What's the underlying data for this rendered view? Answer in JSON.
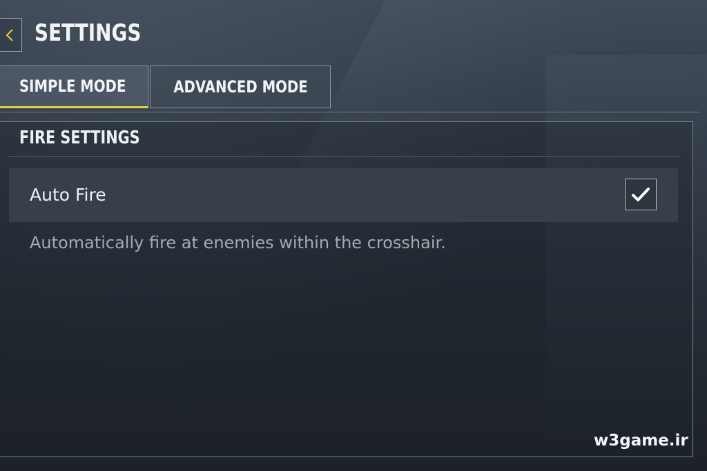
{
  "header": {
    "title": "SETTINGS",
    "back_icon": "chevron-left-icon",
    "accent_color": "#e6d33b"
  },
  "tabs": [
    {
      "label": "SIMPLE MODE",
      "active": true
    },
    {
      "label": "ADVANCED MODE",
      "active": false
    }
  ],
  "section": {
    "title": "FIRE SETTINGS",
    "settings": [
      {
        "label": "Auto Fire",
        "checked": true,
        "control_icon": "checkmark-icon",
        "description": "Automatically fire at enemies within the crosshair."
      }
    ]
  },
  "watermark": "w3game.ir"
}
